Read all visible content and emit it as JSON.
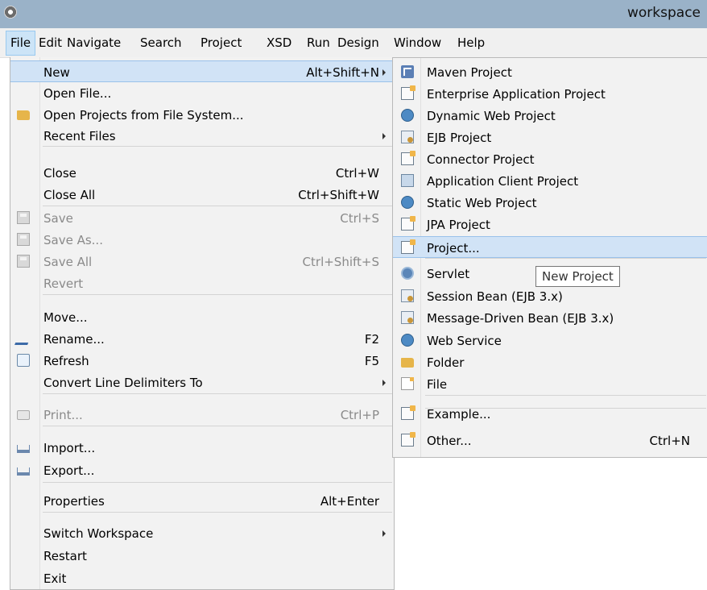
{
  "window": {
    "title": "workspace"
  },
  "menubar": [
    "File",
    "Edit",
    "Navigate",
    "Search",
    "Project",
    "XSD",
    "Run",
    "Design",
    "Window",
    "Help"
  ],
  "file_menu": [
    {
      "label": "New",
      "shortcut": "Alt+Shift+N",
      "arrow": true,
      "highlight": true,
      "icon": "none"
    },
    {
      "label": "Open File...",
      "icon": "none"
    },
    {
      "label": "Open Projects from File System...",
      "icon": "folder-icon"
    },
    {
      "label": "Recent Files",
      "arrow": true,
      "icon": "none"
    },
    {
      "sep": true
    },
    {
      "label": "Close",
      "shortcut": "Ctrl+W",
      "icon": "none"
    },
    {
      "label": "Close All",
      "shortcut": "Ctrl+Shift+W",
      "icon": "none"
    },
    {
      "sep": true
    },
    {
      "label": "Save",
      "shortcut": "Ctrl+S",
      "disabled": true,
      "icon": "disk-icon"
    },
    {
      "label": "Save As...",
      "disabled": true,
      "icon": "disk-icon"
    },
    {
      "label": "Save All",
      "shortcut": "Ctrl+Shift+S",
      "disabled": true,
      "icon": "disk-icon"
    },
    {
      "label": "Revert",
      "disabled": true,
      "icon": "none"
    },
    {
      "sep": true
    },
    {
      "label": "Move...",
      "icon": "none"
    },
    {
      "label": "Rename...",
      "shortcut": "F2",
      "icon": "rename-icon"
    },
    {
      "label": "Refresh",
      "shortcut": "F5",
      "icon": "refresh-icon"
    },
    {
      "label": "Convert Line Delimiters To",
      "arrow": true,
      "icon": "none"
    },
    {
      "sep": true
    },
    {
      "label": "Print...",
      "shortcut": "Ctrl+P",
      "disabled": true,
      "icon": "print-icon"
    },
    {
      "sep": true
    },
    {
      "label": "Import...",
      "icon": "import-icon"
    },
    {
      "label": "Export...",
      "icon": "export-icon"
    },
    {
      "sep": true
    },
    {
      "label": "Properties",
      "shortcut": "Alt+Enter",
      "icon": "none"
    },
    {
      "sep": true
    },
    {
      "label": "Switch Workspace",
      "arrow": true,
      "icon": "none"
    },
    {
      "label": "Restart",
      "icon": "none"
    },
    {
      "label": "Exit",
      "icon": "none"
    }
  ],
  "new_submenu": [
    {
      "label": "Maven Project",
      "icon": "maven-icon"
    },
    {
      "label": "Enterprise Application Project",
      "icon": "ear-project-icon"
    },
    {
      "label": "Dynamic Web Project",
      "icon": "web-project-icon"
    },
    {
      "label": "EJB Project",
      "icon": "ejb-project-icon"
    },
    {
      "label": "Connector Project",
      "icon": "connector-project-icon"
    },
    {
      "label": "Application Client Project",
      "icon": "app-client-project-icon"
    },
    {
      "label": "Static Web Project",
      "icon": "static-web-project-icon"
    },
    {
      "label": "JPA Project",
      "icon": "jpa-project-icon"
    },
    {
      "label": "Project...",
      "icon": "project-icon",
      "highlight": true
    },
    {
      "sep": true
    },
    {
      "label": "Servlet",
      "icon": "servlet-icon"
    },
    {
      "label": "Session Bean (EJB 3.x)",
      "icon": "session-bean-icon"
    },
    {
      "label": "Message-Driven Bean (EJB 3.x)",
      "icon": "message-bean-icon"
    },
    {
      "label": "Web Service",
      "icon": "web-service-icon"
    },
    {
      "label": "Folder",
      "icon": "folder-icon"
    },
    {
      "label": "File",
      "icon": "file-icon"
    },
    {
      "sep": true
    },
    {
      "label": "Example...",
      "icon": "example-icon"
    },
    {
      "sep": true
    },
    {
      "label": "Other...",
      "shortcut": "Ctrl+N",
      "icon": "other-icon"
    }
  ],
  "tooltip": "New Project"
}
